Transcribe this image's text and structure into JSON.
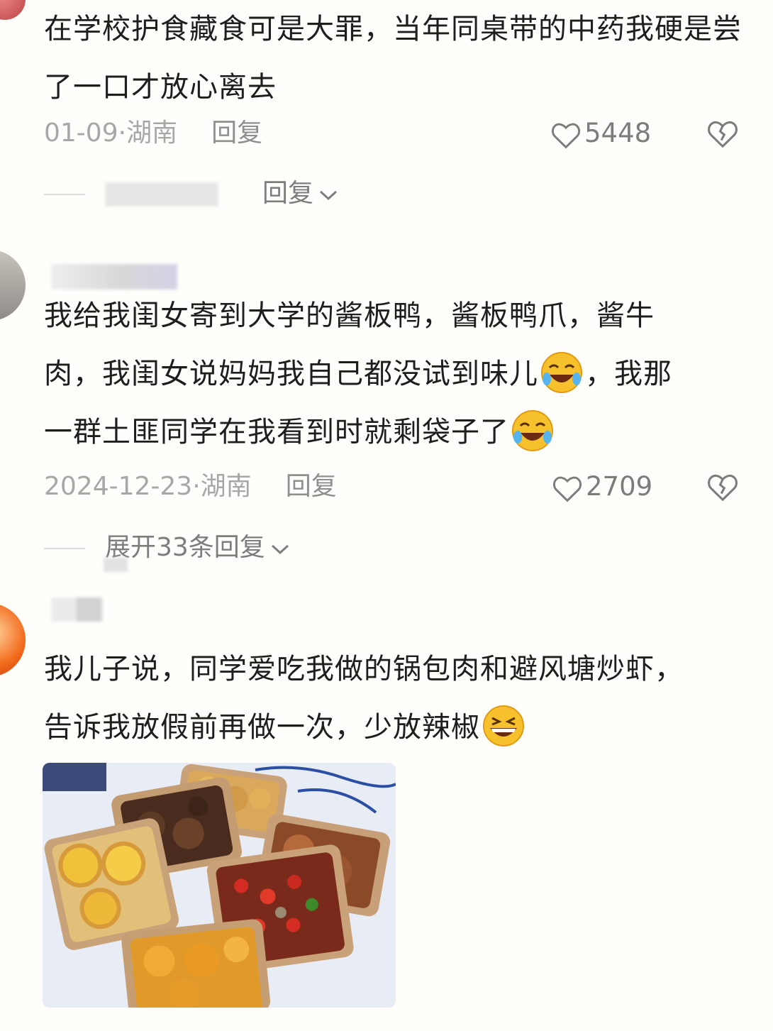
{
  "comments": [
    {
      "text": "在学校护食藏食可是大罪，当年同桌带的中药我硬是尝了一口才放心离去",
      "date": "01-09",
      "location": "湖南",
      "reply_label": "回复",
      "likes": "5448",
      "expand_label": "回复"
    },
    {
      "text_line1": "我给我闺女寄到大学的酱板鸭，酱板鸭爪，酱牛",
      "text_line2a": "肉，我闺女说妈妈我自己都没试到味儿",
      "text_line2b": "，我那",
      "text_line3a": "一群土匪同学在我看到时就剩袋子了",
      "date": "2024-12-23",
      "location": "湖南",
      "reply_label": "回复",
      "likes": "2709",
      "expand_label": "展开33条回复",
      "emoji": "rolling-on-floor-laughing-emoji"
    },
    {
      "text_line1": "我儿子说，同学爱吃我做的锅包肉和避风塘炒虾，",
      "text_line2a": "告诉我放假前再做一次，少放辣椒",
      "emoji": "grinning-squinting-emoji",
      "photo": "food-containers-photo"
    }
  ],
  "separator": " · ",
  "colors": {
    "background": "#fffefb",
    "text": "#1e1e1e",
    "meta": "#a7a7a7"
  }
}
